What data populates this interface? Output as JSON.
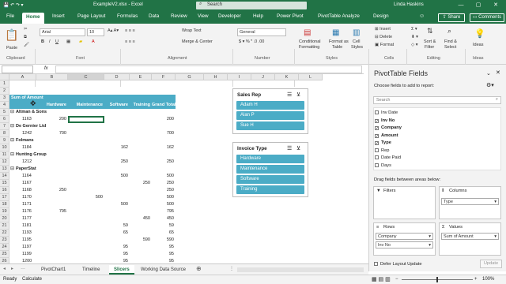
{
  "window": {
    "title": "ExampleV2.xlsx - Excel",
    "search_placeholder": "Search",
    "user": "Linda Haskins",
    "min": "—",
    "max": "▢",
    "close": "✕"
  },
  "ribbon_tabs": [
    "File",
    "Home",
    "Insert",
    "Page Layout",
    "Formulas",
    "Data",
    "Review",
    "View",
    "Developer",
    "Help",
    "Power Pivot",
    "PivotTable Analyze",
    "Design"
  ],
  "share_label": "Share",
  "comments_label": "Comments",
  "ribbon": {
    "clipboard": {
      "group": "Clipboard",
      "paste": "Paste"
    },
    "font": {
      "group": "Font",
      "name": "Arial",
      "size": "10"
    },
    "alignment": {
      "group": "Alignment",
      "wrap": "Wrap Text",
      "merge": "Merge & Center"
    },
    "number": {
      "group": "Number",
      "format": "General"
    },
    "styles": {
      "group": "Styles",
      "cond": "Conditional",
      "cond2": "Formatting",
      "table": "Format as",
      "table2": "Table",
      "cell": "Cell",
      "cell2": "Styles"
    },
    "cells": {
      "group": "Cells",
      "insert": "Insert",
      "delete": "Delete",
      "format": "Format"
    },
    "editing": {
      "group": "Editing",
      "sort": "Sort &",
      "sort2": "Filter",
      "find": "Find &",
      "find2": "Select"
    },
    "ideas": {
      "group": "Ideas",
      "label": "Ideas"
    }
  },
  "formula_bar": {
    "namebox": "",
    "fx": "fx"
  },
  "columns": [
    "A",
    "B",
    "C",
    "D",
    "E",
    "F",
    "G",
    "H",
    "I",
    "J",
    "K",
    "L"
  ],
  "pivot": {
    "title": "Sum of Amount",
    "headers": [
      "Hardware",
      "Maintenance",
      "Software",
      "Training",
      "Grand Total"
    ],
    "rows": [
      {
        "r": "4",
        "label": "",
        "vals": [
          "",
          "",
          "",
          "",
          ""
        ],
        "type": "header"
      },
      {
        "r": "5",
        "label": "Altman & Sons",
        "vals": [
          "",
          "",
          "",
          "",
          ""
        ],
        "type": "group"
      },
      {
        "r": "6",
        "label": "1163",
        "vals": [
          "200",
          "",
          "",
          "",
          "200"
        ],
        "type": "item"
      },
      {
        "r": "7",
        "label": "De Gernier Ltd",
        "vals": [
          "",
          "",
          "",
          "",
          ""
        ],
        "type": "group"
      },
      {
        "r": "8",
        "label": "1242",
        "vals": [
          "700",
          "",
          "",
          "",
          "700"
        ],
        "type": "item"
      },
      {
        "r": "9",
        "label": "Folmans",
        "vals": [
          "",
          "",
          "",
          "",
          ""
        ],
        "type": "group"
      },
      {
        "r": "10",
        "label": "1184",
        "vals": [
          "",
          "",
          "162",
          "",
          "162"
        ],
        "type": "item"
      },
      {
        "r": "11",
        "label": "Hunting Group",
        "vals": [
          "",
          "",
          "",
          "",
          ""
        ],
        "type": "group"
      },
      {
        "r": "12",
        "label": "1212",
        "vals": [
          "",
          "",
          "250",
          "",
          "250"
        ],
        "type": "item"
      },
      {
        "r": "13",
        "label": "PaperStat",
        "vals": [
          "",
          "",
          "",
          "",
          ""
        ],
        "type": "group"
      },
      {
        "r": "14",
        "label": "1164",
        "vals": [
          "",
          "",
          "500",
          "",
          "500"
        ],
        "type": "item"
      },
      {
        "r": "15",
        "label": "1167",
        "vals": [
          "",
          "",
          "",
          "250",
          "250"
        ],
        "type": "item"
      },
      {
        "r": "16",
        "label": "1168",
        "vals": [
          "250",
          "",
          "",
          "",
          "250"
        ],
        "type": "item"
      },
      {
        "r": "17",
        "label": "1170",
        "vals": [
          "",
          "500",
          "",
          "",
          "500"
        ],
        "type": "item"
      },
      {
        "r": "18",
        "label": "1171",
        "vals": [
          "",
          "",
          "500",
          "",
          "500"
        ],
        "type": "item"
      },
      {
        "r": "19",
        "label": "1176",
        "vals": [
          "795",
          "",
          "",
          "",
          "795"
        ],
        "type": "item"
      },
      {
        "r": "20",
        "label": "1177",
        "vals": [
          "",
          "",
          "",
          "450",
          "450"
        ],
        "type": "item"
      },
      {
        "r": "21",
        "label": "1181",
        "vals": [
          "",
          "",
          "59",
          "",
          "59"
        ],
        "type": "item"
      },
      {
        "r": "22",
        "label": "1193",
        "vals": [
          "",
          "",
          "65",
          "",
          "65"
        ],
        "type": "item"
      },
      {
        "r": "23",
        "label": "1195",
        "vals": [
          "",
          "",
          "",
          "590",
          "590"
        ],
        "type": "item"
      },
      {
        "r": "24",
        "label": "1197",
        "vals": [
          "",
          "",
          "95",
          "",
          "95"
        ],
        "type": "item"
      },
      {
        "r": "25",
        "label": "1199",
        "vals": [
          "",
          "",
          "95",
          "",
          "95"
        ],
        "type": "item"
      },
      {
        "r": "26",
        "label": "1200",
        "vals": [
          "",
          "",
          "95",
          "",
          "95"
        ],
        "type": "item"
      },
      {
        "r": "27",
        "label": "1204",
        "vals": [
          "365",
          "",
          "",
          "",
          "365"
        ],
        "type": "item"
      },
      {
        "r": "28",
        "label": "1207",
        "vals": [
          "",
          "",
          "75",
          "",
          "75"
        ],
        "type": "item"
      },
      {
        "r": "29",
        "label": "1209",
        "vals": [
          "1250",
          "",
          "",
          "",
          "1250"
        ],
        "type": "item"
      }
    ]
  },
  "slicers": {
    "sales_rep": {
      "title": "Sales Rep",
      "items": [
        "Adam H",
        "Alan P",
        "Sue H"
      ]
    },
    "invoice_type": {
      "title": "Invoice Type",
      "items": [
        "Hardware",
        "Maintenance",
        "Software",
        "Training"
      ]
    }
  },
  "pane": {
    "title": "PivotTable Fields",
    "subtitle": "Choose fields to add to report:",
    "search_placeholder": "Search",
    "fields": [
      {
        "label": "Inv Date",
        "checked": false
      },
      {
        "label": "Inv No",
        "checked": true
      },
      {
        "label": "Company",
        "checked": true
      },
      {
        "label": "Amount",
        "checked": true
      },
      {
        "label": "Type",
        "checked": true
      },
      {
        "label": "Rep",
        "checked": false
      },
      {
        "label": "Date Paid",
        "checked": false
      },
      {
        "label": "Days",
        "checked": false
      }
    ],
    "drag_label": "Drag fields between areas below:",
    "filters": "Filters",
    "columns": "Columns",
    "rows": "Rows",
    "values": "Values",
    "columns_items": [
      "Type"
    ],
    "rows_items": [
      "Company",
      "Inv No"
    ],
    "values_items": [
      "Sum of Amount"
    ],
    "defer": "Defer Layout Update",
    "update": "Update"
  },
  "sheet_tabs": [
    "PivotChart1",
    "Timeline",
    "Slicers",
    "Working Data Source"
  ],
  "active_sheet": "Slicers",
  "status": {
    "ready": "Ready",
    "calculate": "Calculate",
    "zoom": "100%"
  },
  "colors": {
    "accent": "#217346",
    "pivot_header": "#4bacc6"
  }
}
